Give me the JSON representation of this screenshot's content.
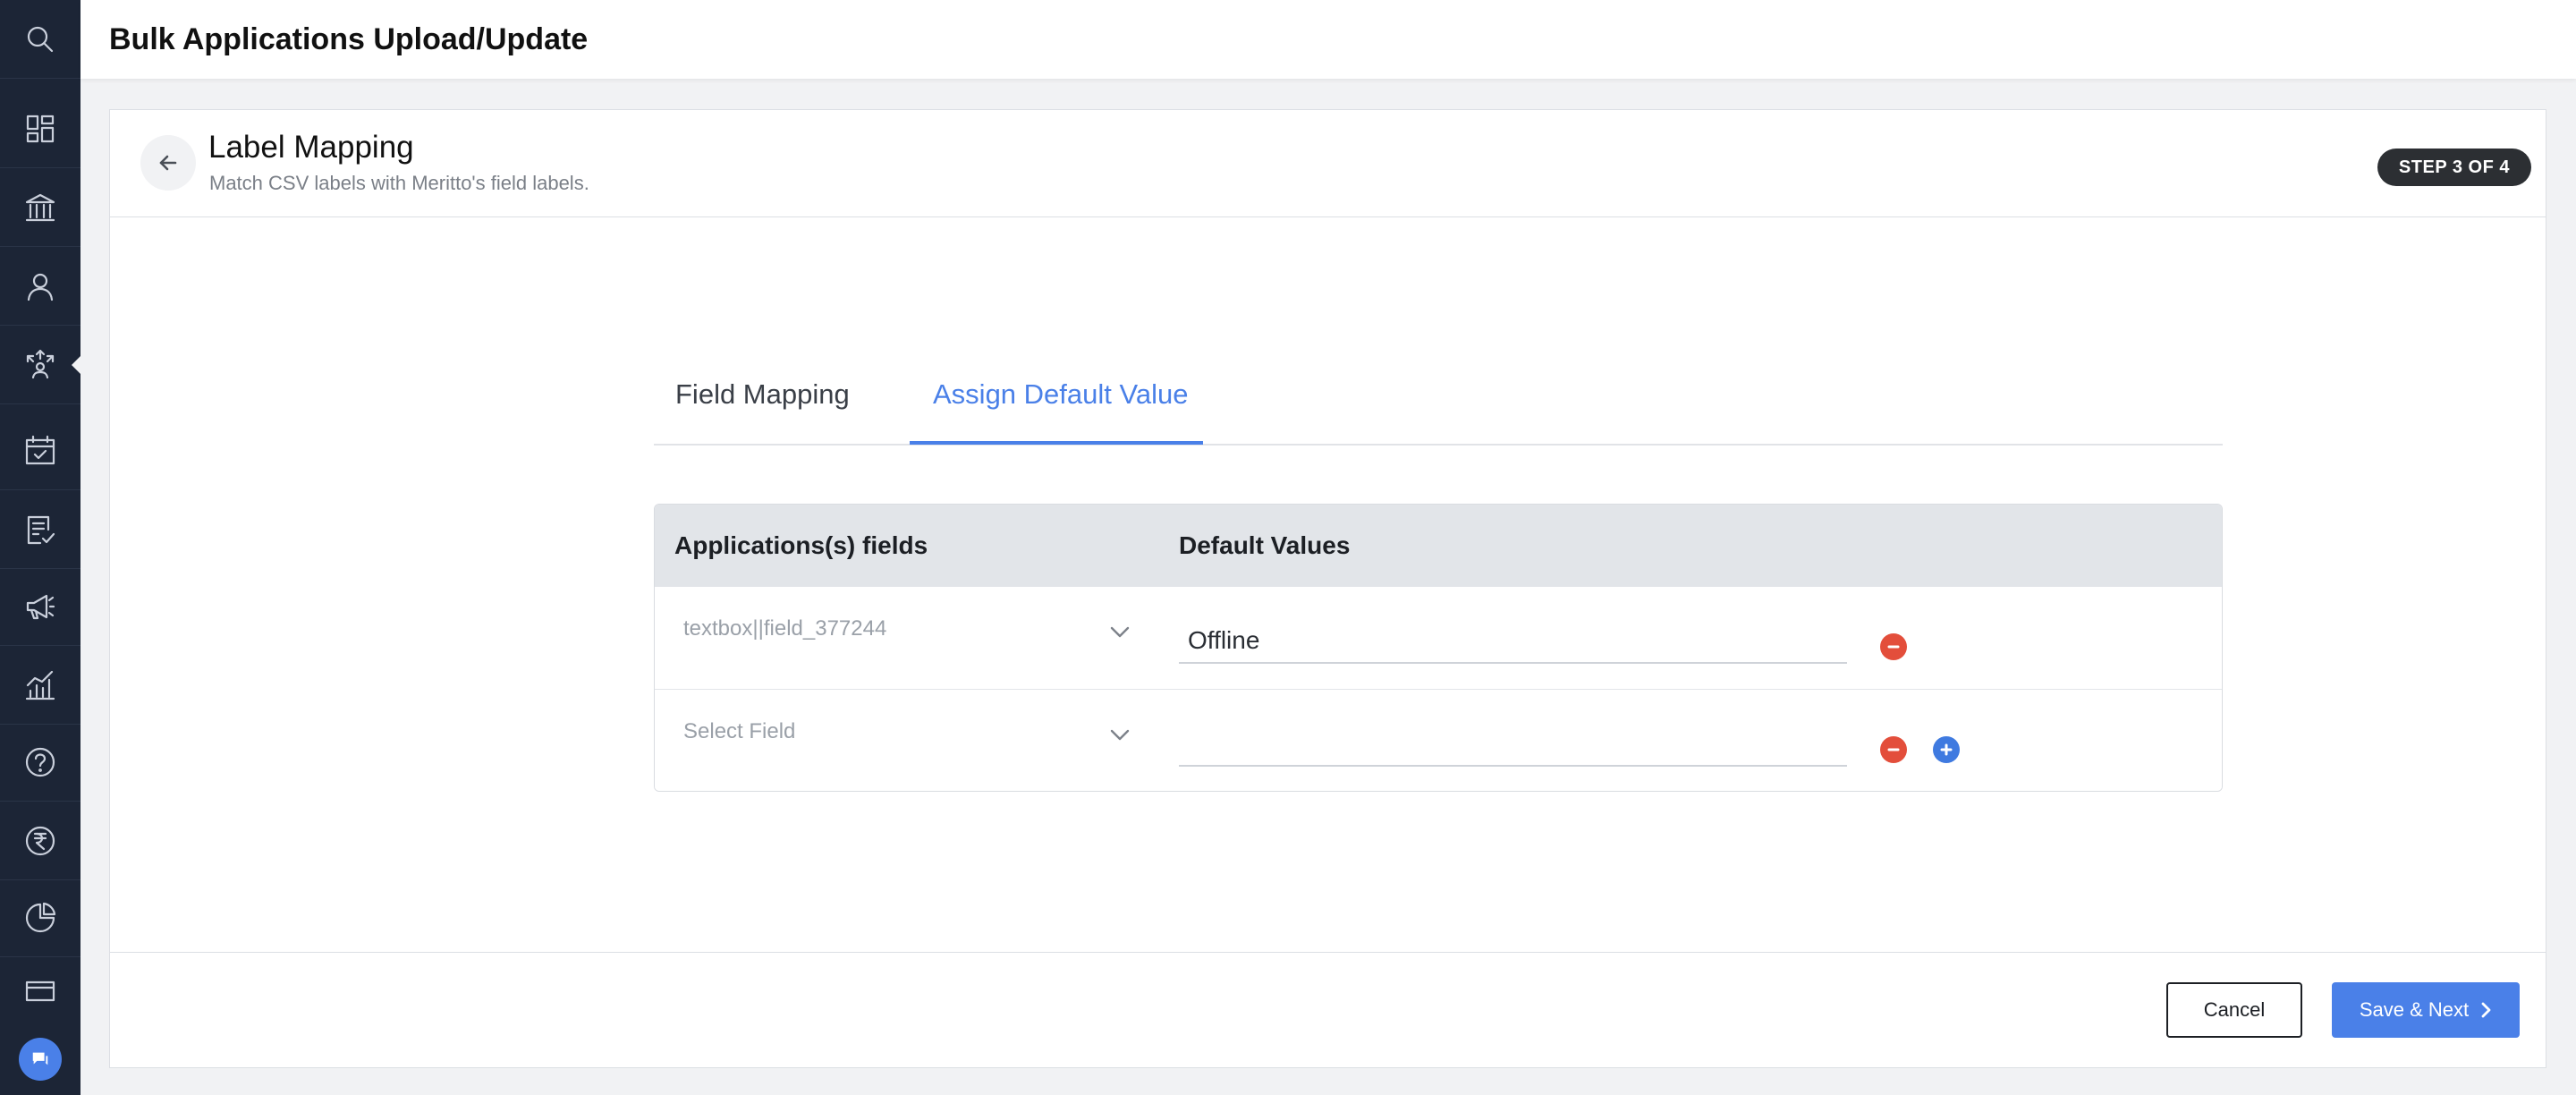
{
  "page": {
    "title": "Bulk Applications Upload/Update"
  },
  "sidebar": {
    "items": [
      {
        "name": "search-icon"
      },
      {
        "name": "dashboard-icon"
      },
      {
        "name": "institution-icon"
      },
      {
        "name": "user-icon"
      },
      {
        "name": "network-icon"
      },
      {
        "name": "calendar-check-icon"
      },
      {
        "name": "form-check-icon"
      },
      {
        "name": "megaphone-icon"
      },
      {
        "name": "analytics-icon"
      },
      {
        "name": "help-icon"
      },
      {
        "name": "rupee-icon"
      },
      {
        "name": "pie-chart-icon"
      },
      {
        "name": "card-icon"
      }
    ],
    "chat": {
      "icon": "chat-icon"
    }
  },
  "header": {
    "title": "Label Mapping",
    "subtitle": "Match CSV labels with Meritto's field labels.",
    "step": "STEP 3 OF 4"
  },
  "tabs": {
    "field_mapping": "Field Mapping",
    "assign_default": "Assign Default Value",
    "active": "assign_default"
  },
  "table": {
    "headers": [
      "Applications(s) fields",
      "Default Values"
    ],
    "rows": [
      {
        "field": "textbox||field_377244",
        "value": "Offline"
      },
      {
        "field": "Select Field",
        "value": ""
      }
    ]
  },
  "footer": {
    "cancel": "Cancel",
    "save": "Save & Next"
  },
  "colors": {
    "accent": "#4a80e8",
    "remove": "#e34e3b",
    "sidebar": "#1c2536"
  }
}
